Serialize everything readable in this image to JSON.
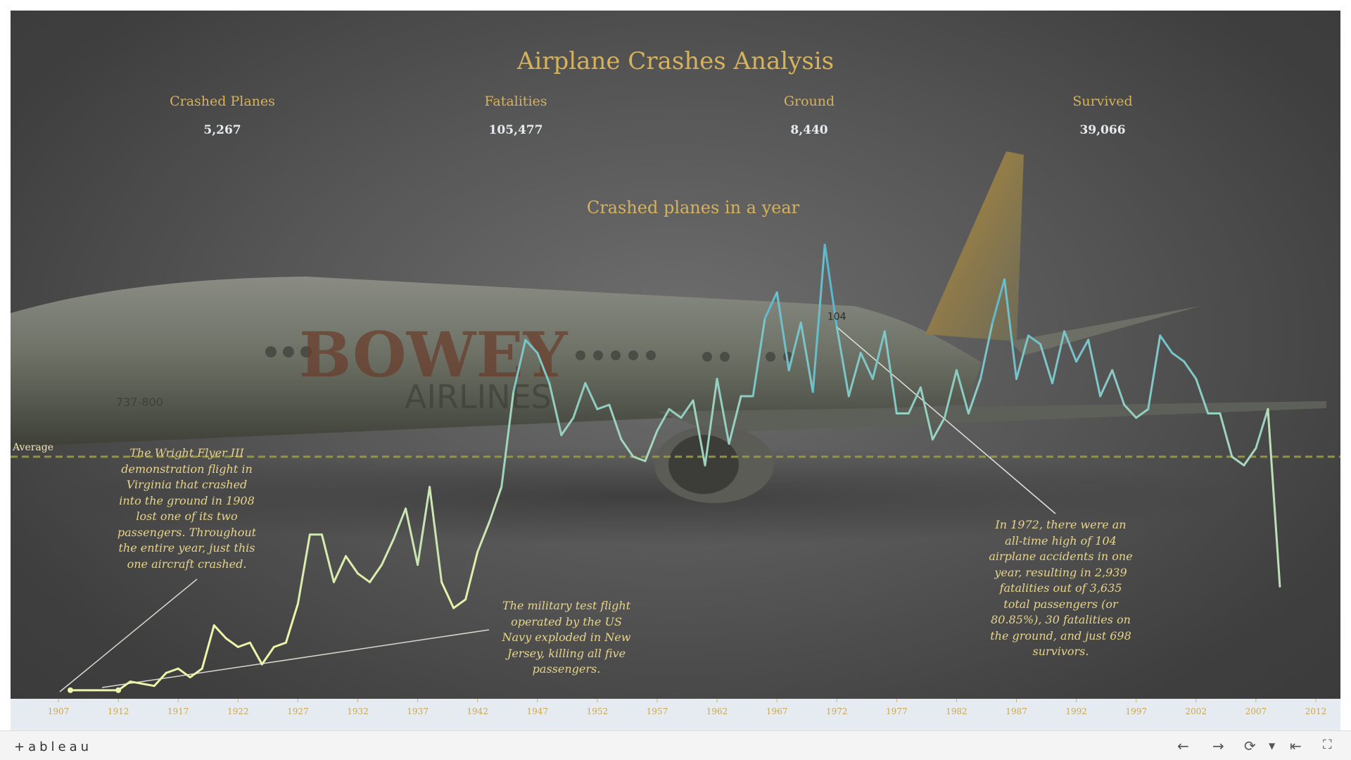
{
  "dashboard": {
    "title": "Airplane Crashes Analysis",
    "kpis": [
      {
        "label": "Crashed Planes",
        "value": "5,267"
      },
      {
        "label": "Fatalities",
        "value": "105,477"
      },
      {
        "label": "Ground",
        "value": "8,440"
      },
      {
        "label": "Survived",
        "value": "39,066"
      }
    ],
    "average_label": "Average",
    "peak_label": "104",
    "annotations": {
      "wright": "The Wright Flyer III demonstration flight in Virginia that crashed into the ground in 1908 lost one of its two passengers. Throughout the entire year, just this one aircraft crashed.",
      "navy": "The military test flight operated by the US Navy exploded in New Jersey, killing all five passengers.",
      "peak": "In 1972, there were an all-time high of 104 airplane accidents in one year, resulting in 2,939 fatalities out of 3,635 total passengers (or 80.85%), 30 fatalities on the ground, and just 698 survivors."
    },
    "background_livery": {
      "brand": "BOWEY",
      "sub": "AIRLINES",
      "model": "737-800"
    }
  },
  "chart_data": {
    "type": "line",
    "title": "Crashed planes in a year",
    "x": [
      1908,
      1912,
      1913,
      1915,
      1916,
      1917,
      1918,
      1919,
      1920,
      1921,
      1922,
      1923,
      1924,
      1925,
      1926,
      1927,
      1928,
      1929,
      1930,
      1931,
      1932,
      1933,
      1934,
      1935,
      1936,
      1937,
      1938,
      1939,
      1940,
      1941,
      1942,
      1943,
      1944,
      1945,
      1946,
      1947,
      1948,
      1949,
      1950,
      1951,
      1952,
      1953,
      1954,
      1955,
      1956,
      1957,
      1958,
      1959,
      1960,
      1961,
      1962,
      1963,
      1964,
      1965,
      1966,
      1967,
      1968,
      1969,
      1970,
      1971,
      1972,
      1973,
      1974,
      1975,
      1976,
      1977,
      1978,
      1979,
      1980,
      1981,
      1982,
      1983,
      1984,
      1985,
      1986,
      1987,
      1988,
      1989,
      1990,
      1991,
      1992,
      1993,
      1994,
      1995,
      1996,
      1997,
      1998,
      1999,
      2000,
      2001,
      2002,
      2003,
      2004,
      2005,
      2006,
      2007,
      2008,
      2009
    ],
    "y": [
      1,
      1,
      3,
      2,
      5,
      6,
      4,
      6,
      16,
      13,
      11,
      12,
      7,
      11,
      12,
      21,
      37,
      37,
      26,
      32,
      28,
      26,
      30,
      36,
      43,
      30,
      48,
      26,
      20,
      22,
      33,
      40,
      48,
      70,
      82,
      79,
      72,
      60,
      64,
      72,
      66,
      67,
      59,
      55,
      54,
      61,
      66,
      64,
      68,
      53,
      73,
      58,
      69,
      69,
      87,
      93,
      75,
      86,
      70,
      104,
      85,
      69,
      79,
      73,
      84,
      65,
      65,
      71,
      59,
      64,
      75,
      65,
      73,
      86,
      96,
      73,
      83,
      81,
      72,
      84,
      77,
      82,
      69,
      75,
      67,
      64,
      66,
      83,
      79,
      77,
      73,
      65,
      65,
      55,
      53,
      57,
      66,
      25
    ],
    "average": 55,
    "peak": {
      "year": 1972,
      "value": 104
    },
    "x_ticks": [
      "1907",
      "1912",
      "1917",
      "1922",
      "1927",
      "1932",
      "1937",
      "1942",
      "1947",
      "1952",
      "1957",
      "1962",
      "1967",
      "1972",
      "1977",
      "1982",
      "1987",
      "1992",
      "1997",
      "2002",
      "2007",
      "2012"
    ],
    "x_min": 1907,
    "x_max": 2012,
    "y_min": 0,
    "y_max": 110,
    "color_low": "#eef5a8",
    "color_high": "#4fb3d4",
    "average_color": "#9a9a48"
  },
  "footer": {
    "logo": "+ableau",
    "controls": [
      "undo",
      "redo",
      "revert",
      "more",
      "reset",
      "fullscreen"
    ]
  }
}
